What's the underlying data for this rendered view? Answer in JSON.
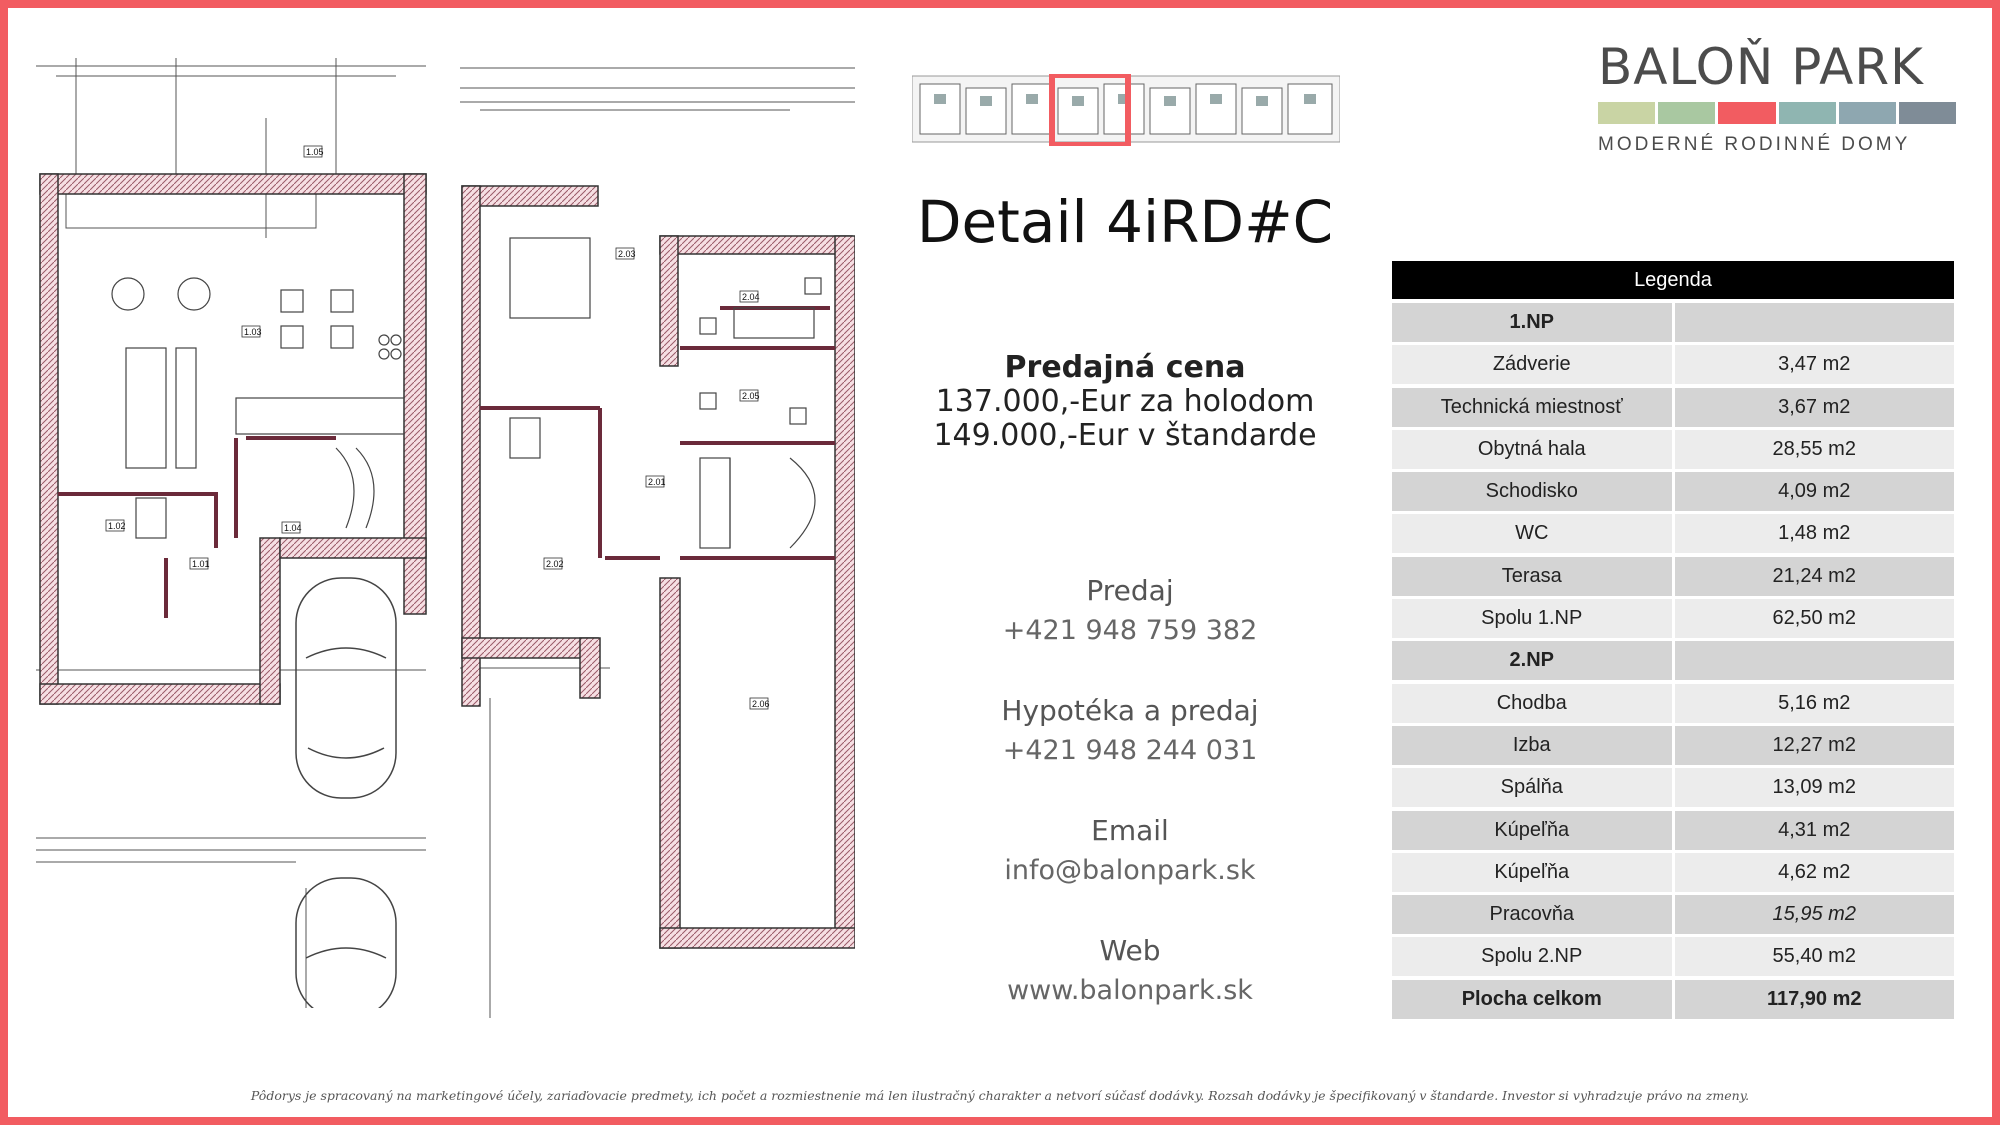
{
  "brand": {
    "name": "BALOŇ PARK",
    "tagline": "MODERNÉ RODINNÉ DOMY",
    "bar_colors": [
      "#c9d4a4",
      "#a9c8a1",
      "#f25c61",
      "#8fb5b1",
      "#8ea7b0",
      "#7f8c97"
    ]
  },
  "title": "Detail 4iRD#C",
  "price": {
    "heading": "Predajná cena",
    "lines": [
      "137.000,-Eur za holodom",
      "149.000,-Eur v štandarde"
    ]
  },
  "contacts": [
    {
      "label": "Predaj",
      "value": "+421 948 759 382"
    },
    {
      "label": "Hypotéka a predaj",
      "value": "+421 948 244 031"
    },
    {
      "label": "Email",
      "value": "info@balonpark.sk"
    },
    {
      "label": "Web",
      "value": "www.balonpark.sk"
    }
  ],
  "legend": {
    "title": "Legenda",
    "rows": [
      {
        "name": "1.NP",
        "area": "",
        "style": "section"
      },
      {
        "name": "Zádverie",
        "area": "3,47 m2"
      },
      {
        "name": "Technická miestnosť",
        "area": "3,67 m2"
      },
      {
        "name": "Obytná hala",
        "area": "28,55 m2"
      },
      {
        "name": "Schodisko",
        "area": "4,09 m2"
      },
      {
        "name": "WC",
        "area": "1,48 m2"
      },
      {
        "name": "Terasa",
        "area": "21,24 m2"
      },
      {
        "name": "Spolu 1.NP",
        "area": "62,50 m2"
      },
      {
        "name": "2.NP",
        "area": "",
        "style": "section"
      },
      {
        "name": "Chodba",
        "area": "5,16 m2"
      },
      {
        "name": "Izba",
        "area": "12,27 m2"
      },
      {
        "name": "Spálňa",
        "area": "13,09 m2"
      },
      {
        "name": "Kúpeľňa",
        "area": "4,31 m2"
      },
      {
        "name": "Kúpeľňa",
        "area": "4,62 m2"
      },
      {
        "name": "Pracovňa",
        "area": "15,95 m2",
        "style": "italic-area"
      },
      {
        "name": "Spolu 2.NP",
        "area": "55,40 m2"
      },
      {
        "name": "Plocha celkom",
        "area": "117,90 m2",
        "style": "total"
      }
    ]
  },
  "floorplan": {
    "labels_1np": [
      "1.05",
      "1.03",
      "1.02",
      "1.01",
      "1.04"
    ],
    "labels_2np": [
      "2.03",
      "2.04",
      "2.05",
      "2.01",
      "2.02",
      "2.06"
    ],
    "accent": "#f25c61"
  },
  "footnote": "Pôdorys je spracovaný na marketingové účely, zariaďovacie predmety, ich počet a rozmiestnenie má len ilustračný charakter a netvorí súčasť dodávky. Rozsah dodávky je špecifikovaný v štandarde. Investor si vyhradzuje právo na zmeny."
}
